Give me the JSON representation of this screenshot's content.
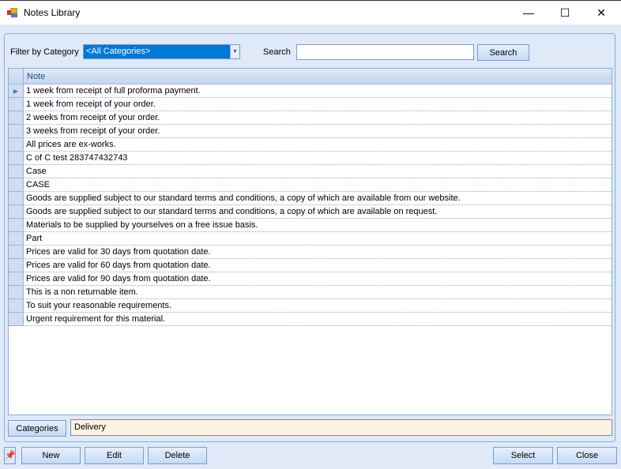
{
  "window": {
    "title": "Notes Library",
    "minimize": "—",
    "maximize": "☐",
    "close": "✕"
  },
  "filter": {
    "label": "Filter by Category",
    "selected": "<All Categories>",
    "search_label": "Search",
    "search_value": "",
    "search_button": "Search"
  },
  "grid": {
    "column": "Note",
    "rows": [
      "1 week from receipt of full proforma payment.",
      "1 week from receipt of your order.",
      "2 weeks from receipt of your order.",
      "3 weeks from receipt of your order.",
      "All prices are ex-works.",
      "C of C test 283747432743",
      "Case",
      "CASE",
      "Goods are supplied subject to our standard terms and conditions, a copy of which are available from our website.",
      "Goods are supplied subject to our standard terms and conditions, a copy of which are available on request.",
      "Materials to be supplied by yourselves on a free issue basis.",
      "Part",
      "Prices are valid for 30 days from quotation date.",
      "Prices are valid for 60 days from quotation date.",
      "Prices are valid for 90 days from quotation date.",
      "This is a non returnable item.",
      "To suit your reasonable requirements.",
      "Urgent requirement for this material."
    ]
  },
  "categories": {
    "button": "Categories",
    "value": "Delivery"
  },
  "footer": {
    "new": "New",
    "edit": "Edit",
    "delete": "Delete",
    "select": "Select",
    "close": "Close"
  }
}
